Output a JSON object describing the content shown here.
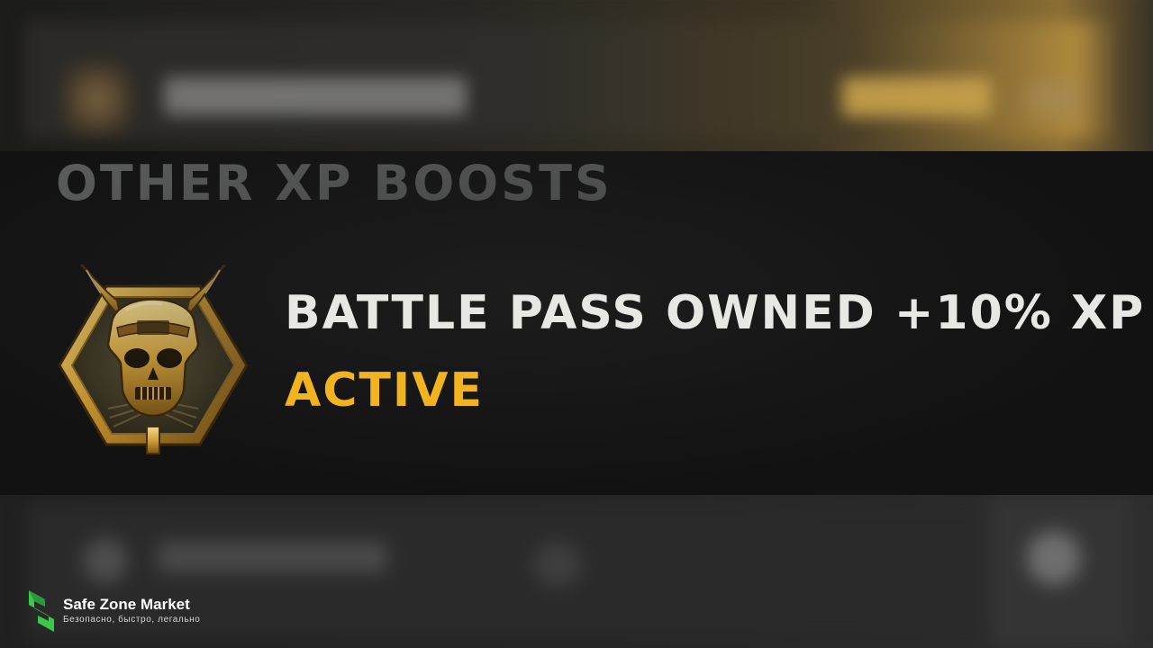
{
  "section": {
    "title": "OTHER XP BOOSTS"
  },
  "boost": {
    "name": "BATTLE PASS OWNED +10% XP",
    "status": "ACTIVE",
    "icon": "battle-pass-skull-emblem-icon"
  },
  "watermark": {
    "name": "Safe Zone Market",
    "tagline": "Безопасно, быстро, легально"
  },
  "colors": {
    "status_active": "#f2b41e",
    "title_gray": "#5c5d5d",
    "boost_text": "#e7e7e4",
    "gold_accent": "#c9a24a",
    "watermark_green": "#3cc84a"
  }
}
